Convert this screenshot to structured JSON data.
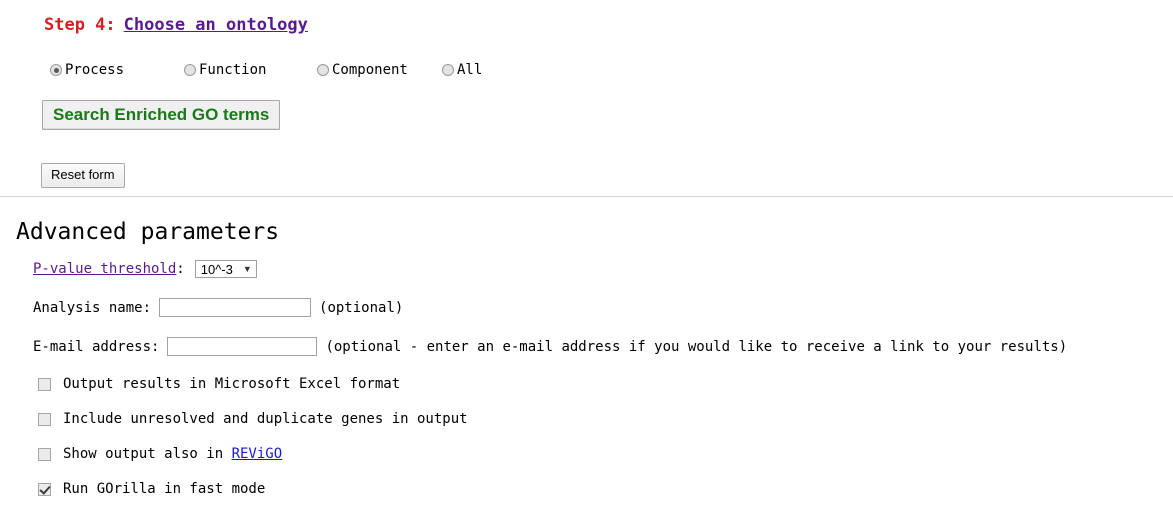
{
  "step": {
    "label": "Step 4:",
    "link_text": "Choose an ontology",
    "label_color": "#d32020",
    "link_color": "#5b1a8c"
  },
  "ontology": {
    "options": [
      {
        "label": "Process",
        "checked": true
      },
      {
        "label": "Function",
        "checked": false
      },
      {
        "label": "Component",
        "checked": false
      },
      {
        "label": "All",
        "checked": false
      }
    ]
  },
  "buttons": {
    "search_label": "Search Enriched GO terms",
    "search_color": "#1a7a1a",
    "reset_label": "Reset form"
  },
  "advanced": {
    "title": "Advanced parameters",
    "pvalue": {
      "link_text": "P-value threshold",
      "colon": ":",
      "selected": "10^-3",
      "caret": "▼"
    },
    "analysis": {
      "label": "Analysis name:",
      "value": "",
      "placeholder": "",
      "hint": "(optional)"
    },
    "email": {
      "label": "E-mail address:",
      "value": "",
      "placeholder": "",
      "hint": "(optional - enter an e-mail address if you would like to receive a link to your results)"
    },
    "checkboxes": [
      {
        "label": "Output results in Microsoft Excel format",
        "checked": false
      },
      {
        "label": "Include unresolved and duplicate genes in output",
        "checked": false
      },
      {
        "label_prefix": "Show output also in ",
        "link_text": "REViGO",
        "checked": false
      },
      {
        "label": "Run GOrilla in fast mode",
        "checked": true
      }
    ]
  }
}
